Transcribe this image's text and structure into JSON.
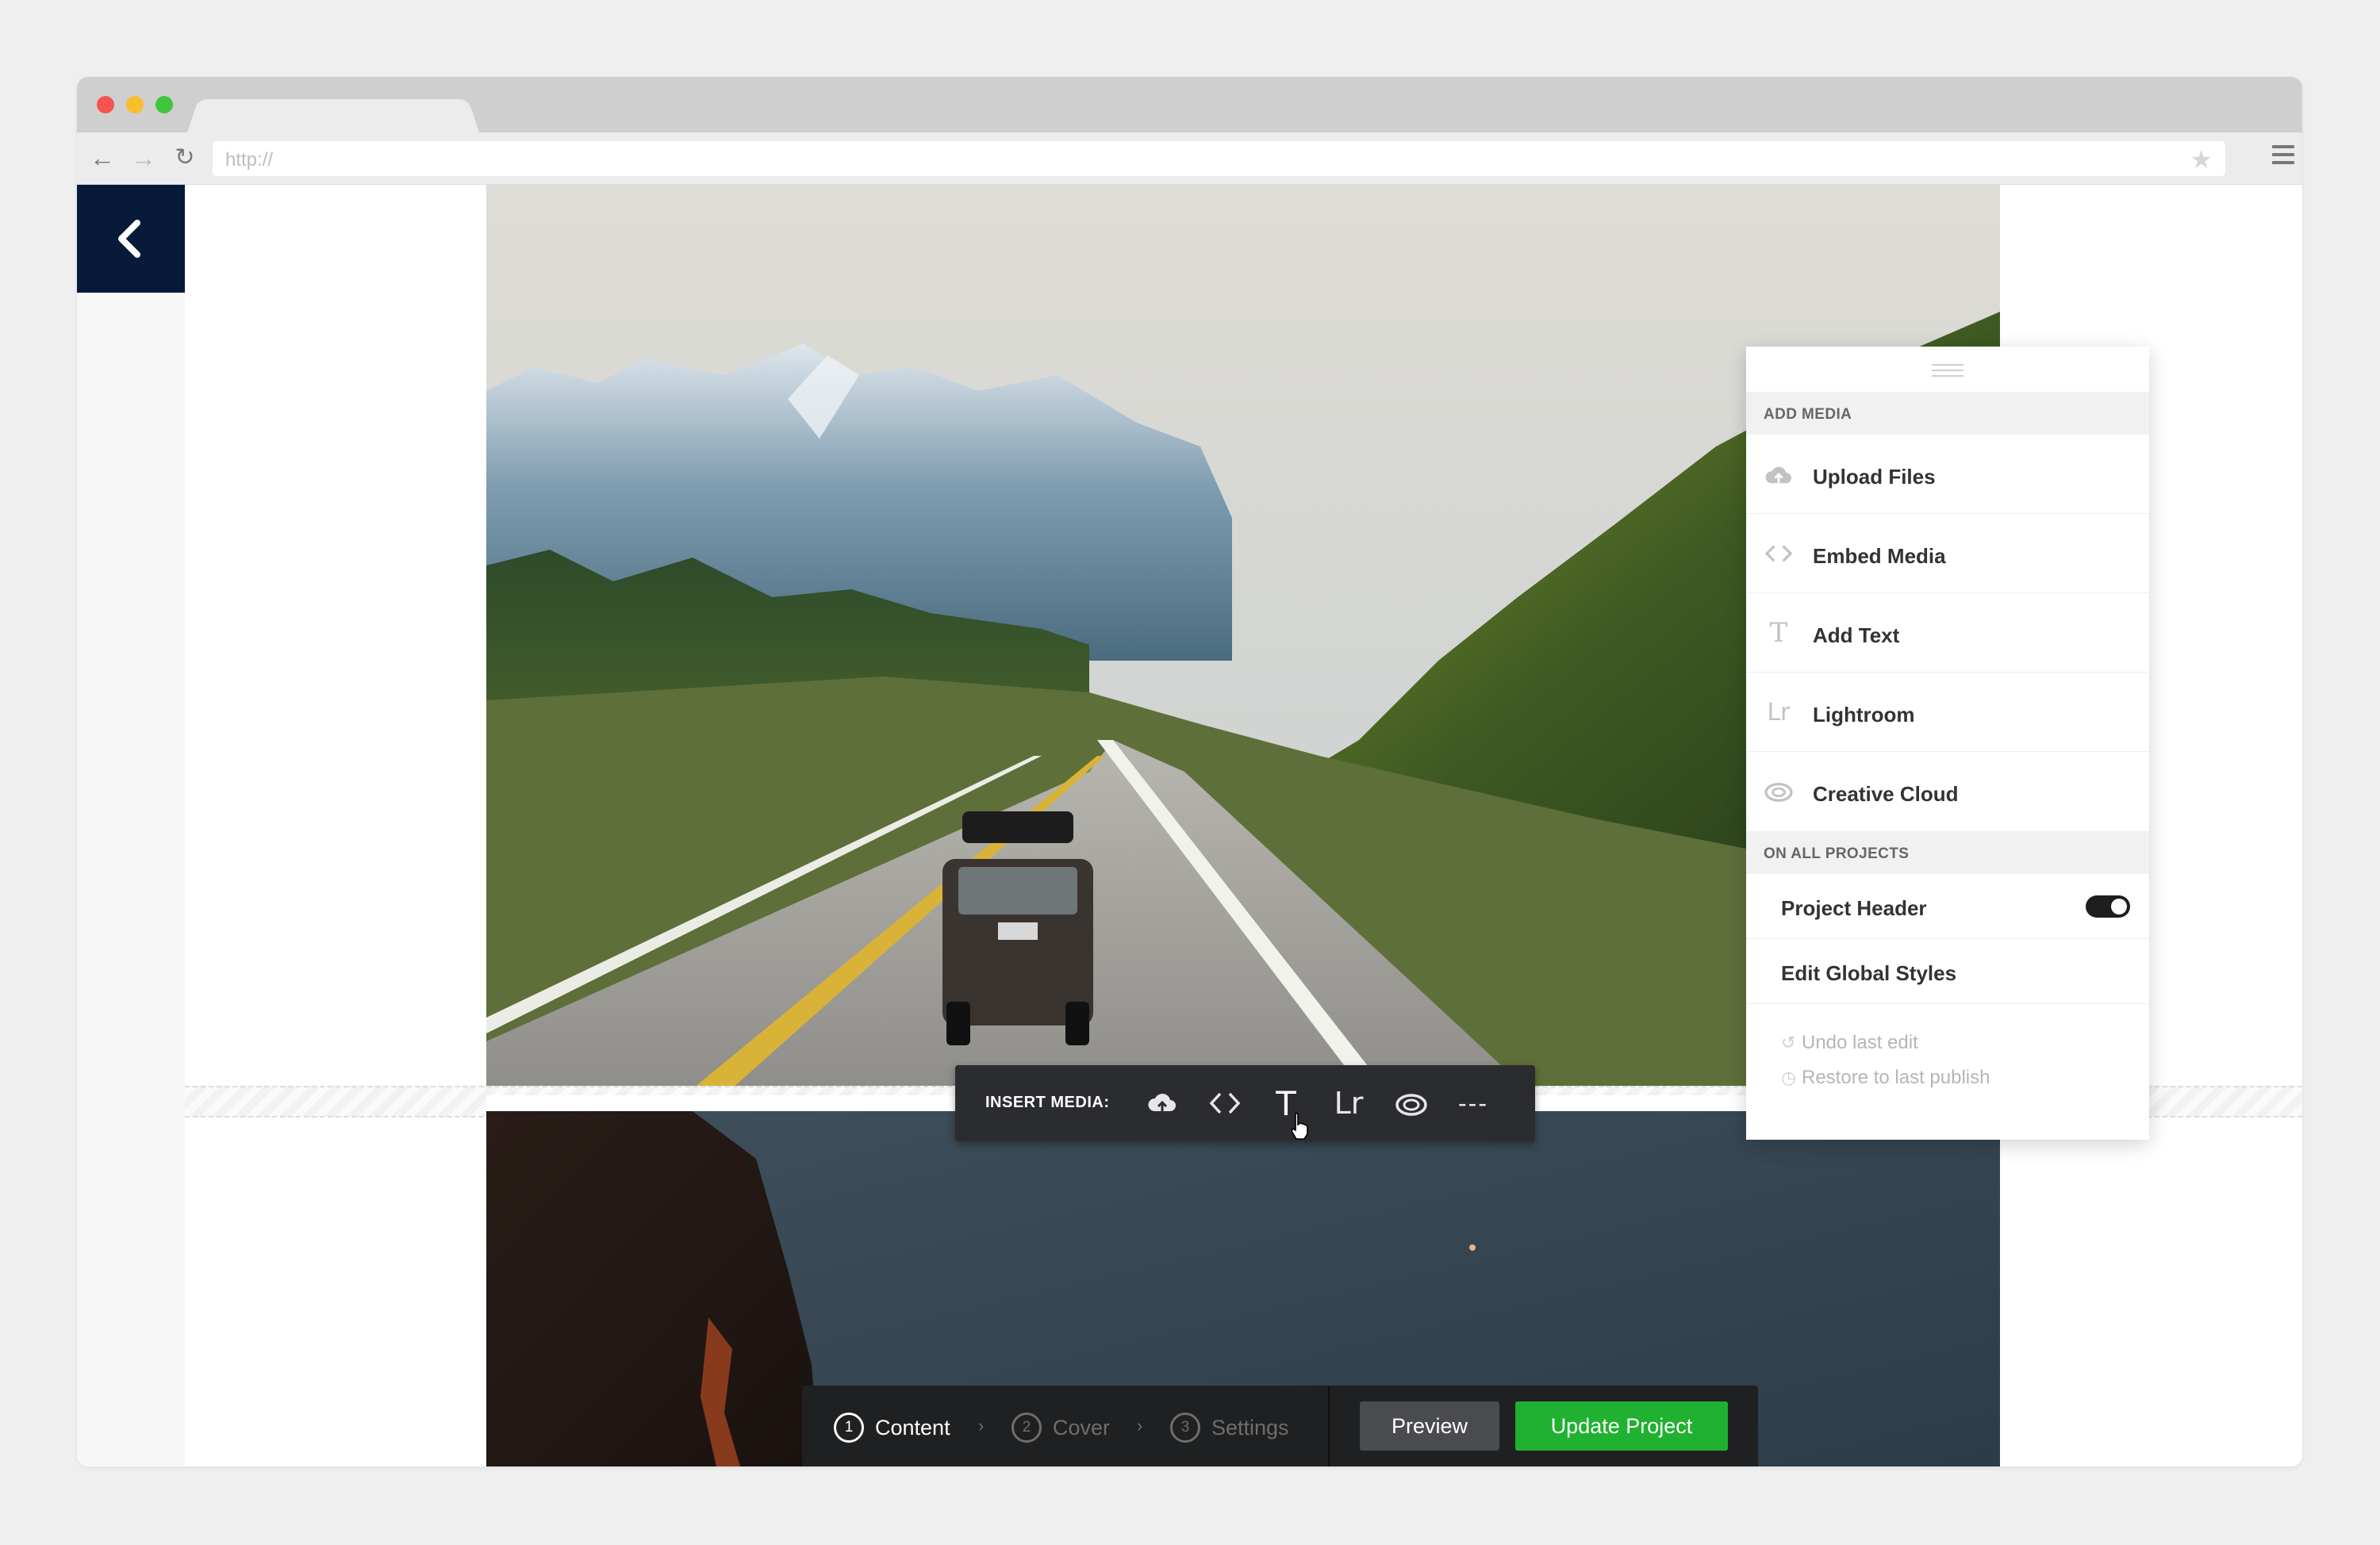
{
  "browser": {
    "address_placeholder": "http://",
    "icons": [
      "back-arrow-icon",
      "forward-arrow-icon",
      "reload-icon",
      "star-icon",
      "hamburger-menu-icon"
    ]
  },
  "page": {
    "back_icon": "chevron-left-icon"
  },
  "insert_media": {
    "label": "INSERT MEDIA:",
    "icons": [
      "cloud-upload-icon",
      "code-embed-icon",
      "text-icon",
      "lightroom-icon",
      "creative-cloud-icon",
      "more-icon"
    ],
    "text_glyph": "T",
    "lightroom_glyph": "Lr",
    "more_glyph": "---"
  },
  "panel": {
    "add_media_header": "ADD MEDIA",
    "items": [
      {
        "label": "Upload Files",
        "icon": "cloud-upload-icon"
      },
      {
        "label": "Embed Media",
        "icon": "code-embed-icon"
      },
      {
        "label": "Add Text",
        "icon": "text-icon"
      },
      {
        "label": "Lightroom",
        "icon": "lightroom-icon"
      },
      {
        "label": "Creative Cloud",
        "icon": "creative-cloud-icon"
      }
    ],
    "text_glyph": "T",
    "lightroom_glyph": "Lr",
    "all_projects_header": "ON ALL PROJECTS",
    "project_header_label": "Project Header",
    "project_header_on": true,
    "edit_global_styles": "Edit Global Styles",
    "undo": "Undo last edit",
    "restore": "Restore to last publish"
  },
  "action_bar": {
    "steps": [
      {
        "num": "1",
        "label": "Content",
        "active": true
      },
      {
        "num": "2",
        "label": "Cover",
        "active": false
      },
      {
        "num": "3",
        "label": "Settings",
        "active": false
      }
    ],
    "separator": "›",
    "preview": "Preview",
    "update": "Update Project",
    "update_color": "#1fb12f"
  }
}
